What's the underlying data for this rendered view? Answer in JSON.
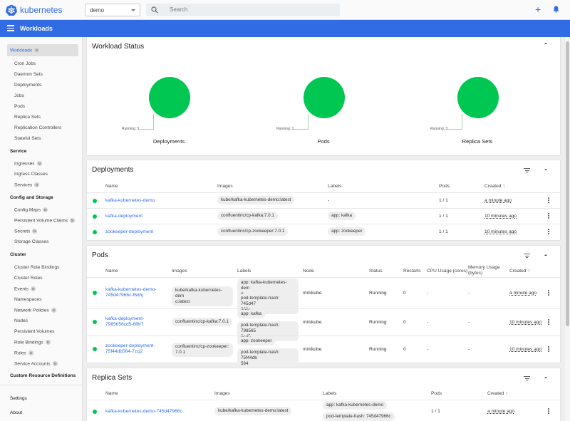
{
  "header": {
    "brand": "kubernetes",
    "namespace": "demo",
    "search_placeholder": "Search",
    "plus": "+"
  },
  "titlebar": {
    "title": "Workloads"
  },
  "sidebar": {
    "workloads": "Workloads",
    "workload_items": [
      "Cron Jobs",
      "Daemon Sets",
      "Deployments",
      "Jobs",
      "Pods",
      "Replica Sets",
      "Replication Controllers",
      "Stateful Sets"
    ],
    "service_header": "Service",
    "service_items": [
      "Ingresses",
      "Ingress Classes",
      "Services"
    ],
    "config_header": "Config and Storage",
    "config_items": [
      "Config Maps",
      "Persistent Volume Claims",
      "Secrets",
      "Storage Classes"
    ],
    "cluster_header": "Cluster",
    "cluster_items": [
      "Cluster Role Bindings",
      "Cluster Roles",
      "Events",
      "Namespaces",
      "Network Policies",
      "Nodes",
      "Persistent Volumes",
      "Role Bindings",
      "Roles",
      "Service Accounts"
    ],
    "crd": "Custom Resource Definitions",
    "settings": "Settings",
    "about": "About",
    "ns_badge": "N"
  },
  "workload_status": {
    "title": "Workload Status",
    "charts": [
      {
        "label": "Deployments",
        "running": "Running: 3"
      },
      {
        "label": "Pods",
        "running": "Running: 3"
      },
      {
        "label": "Replica Sets",
        "running": "Running: 3"
      }
    ]
  },
  "deployments": {
    "title": "Deployments",
    "headers": [
      "Name",
      "Images",
      "Labels",
      "Pods",
      "Created"
    ],
    "sort_arrow": "↑",
    "rows": [
      {
        "name": "kafka-kubernetes-demo",
        "image": "kube/kafka-kubernetes-demo:latest",
        "label": "-",
        "pods": "1 / 1",
        "created": "a minute ago"
      },
      {
        "name": "kafka-deployment",
        "image": "confluentinc/cp-kafka:7.0.1",
        "label": "app: kafka",
        "pods": "1 / 1",
        "created": "10 minutes ago"
      },
      {
        "name": "zookeeper-deployment",
        "image": "confluentinc/cp-zookeeper:7.0.1",
        "label": "app: zookeeper",
        "pods": "1 / 1",
        "created": "10 minutes ago"
      }
    ]
  },
  "pods": {
    "title": "Pods",
    "headers": [
      "Name",
      "Images",
      "Labels",
      "Node",
      "Status",
      "Restarts",
      "CPU Usage (cores)",
      "Memory Usage (bytes)",
      "Created"
    ],
    "sort_arrow": "↑",
    "rows": [
      {
        "name1": "kafka-kubernetes-demo-",
        "name2": "745d47966c-f6dhj",
        "image1": "kube/kafka-kubernetes-dem",
        "image2": "o:latest",
        "label1a": "app: kafka-kubernetes-dem",
        "label1b": "o",
        "label2a": "pod-template-hash: 745d47",
        "label2b": "966c",
        "node": "minikube",
        "status": "Running",
        "restarts": "0",
        "cpu": "-",
        "mem": "-",
        "created": "a minute ago"
      },
      {
        "name1": "kafka-deployment-",
        "name2": "7985656cd5-8f8r7",
        "image1": "confluentinc/cp-kafka:7.0.1",
        "image2": "",
        "label1a": "app: kafka",
        "label1b": "",
        "label2a": "pod-template-hash: 798565",
        "label2b": "6cd5",
        "node": "minikube",
        "status": "Running",
        "restarts": "0",
        "cpu": "-",
        "mem": "-",
        "created": "10 minutes ago"
      },
      {
        "name1": "zookeeper-deployment-",
        "name2": "75f44db564-7zcj2",
        "image1": "confluentinc/cp-zookeeper:",
        "image2": "7.0.1",
        "label1a": "app: zookeeper",
        "label1b": "",
        "label2a": "pod-template-hash: 75f44db",
        "label2b": "564",
        "node": "minikube",
        "status": "Running",
        "restarts": "0",
        "cpu": "-",
        "mem": "-",
        "created": "10 minutes ago"
      }
    ]
  },
  "replicasets": {
    "title": "Replica Sets",
    "headers": [
      "Name",
      "Images",
      "Labels",
      "Pods",
      "Created"
    ],
    "sort_arrow": "↑",
    "rows": [
      {
        "name": "kafka-kubernetes-demo-745d47966c",
        "image": "kube/kafka-kubernetes-demo:latest",
        "label1": "app: kafka-kubernetes-demo",
        "label2": "pod-template-hash: 745d47966c",
        "pods": "1 / 1",
        "created": "a minute ago"
      }
    ]
  },
  "colors": {
    "accent": "#326ce5",
    "running": "#00c752"
  }
}
